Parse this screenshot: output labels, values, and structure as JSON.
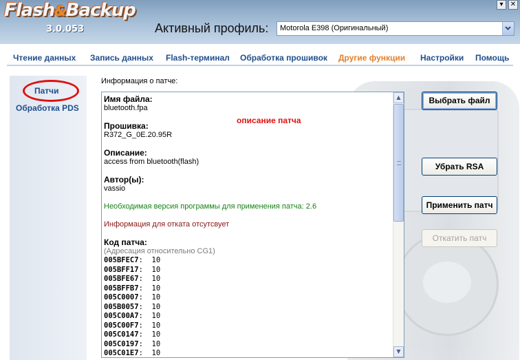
{
  "window": {
    "logo_part1": "Flash",
    "logo_amp": "&",
    "logo_part2": "Backup",
    "version": "3.0.053",
    "minimize_glyph": "▾",
    "close_glyph": "✕"
  },
  "profile": {
    "label": "Активный профиль:",
    "selected": "Motorola E398 (Оригинальный)",
    "arrow_glyph": "▾"
  },
  "nav": {
    "items": [
      {
        "label": "Чтение данных",
        "active": false
      },
      {
        "label": "Запись данных",
        "active": false
      },
      {
        "label": "Flash-терминал",
        "active": false
      },
      {
        "label": "Обработка прошивок",
        "active": false
      },
      {
        "label": "Другие функции",
        "active": true
      },
      {
        "label": "Настройки",
        "active": false
      },
      {
        "label": "Помощь",
        "active": false
      }
    ],
    "active_color": "#e2812c",
    "color": "#1f4e8c"
  },
  "sidebar": {
    "items": [
      {
        "label": "Патчи",
        "highlighted": true
      },
      {
        "label": "Обработка PDS",
        "highlighted": false
      }
    ]
  },
  "main": {
    "info_label": "Информация о патче:",
    "annotation": "описание патча",
    "patch": {
      "filename_label": "Имя файла:",
      "filename": "bluetooth.fpa",
      "firmware_label": "Прошивка:",
      "firmware": "R372_G_0E.20.95R",
      "description_label": "Описание:",
      "description": "access from bluetooth(flash)",
      "authors_label": "Автор(ы):",
      "authors": "vassio",
      "required_version": "Необходимая версия программы для применения патча: 2.6",
      "rollback_info": "Информация для отката отсутсвует",
      "code_label": "Код патча:",
      "addressing_note": "(Адресация относительно CG1)",
      "code_lines": [
        {
          "addr": "005BFEC7",
          "val": "10"
        },
        {
          "addr": "005BFF17",
          "val": "10"
        },
        {
          "addr": "005BFE67",
          "val": "10"
        },
        {
          "addr": "005BFFB7",
          "val": "10"
        },
        {
          "addr": "005C0007",
          "val": "10"
        },
        {
          "addr": "005B0057",
          "val": "10"
        },
        {
          "addr": "005C00A7",
          "val": "10"
        },
        {
          "addr": "005C00F7",
          "val": "10"
        },
        {
          "addr": "005C0147",
          "val": "10"
        },
        {
          "addr": "005C0197",
          "val": "10"
        },
        {
          "addr": "005C01E7",
          "val": "10"
        }
      ]
    }
  },
  "buttons": {
    "select_file": "Выбрать файл",
    "remove_rsa": "Убрать RSA",
    "apply_patch": "Применить патч",
    "rollback_patch": "Откатить патч",
    "rollback_enabled": false
  },
  "scrollbar": {
    "up_glyph": "▲",
    "down_glyph": "▼"
  }
}
